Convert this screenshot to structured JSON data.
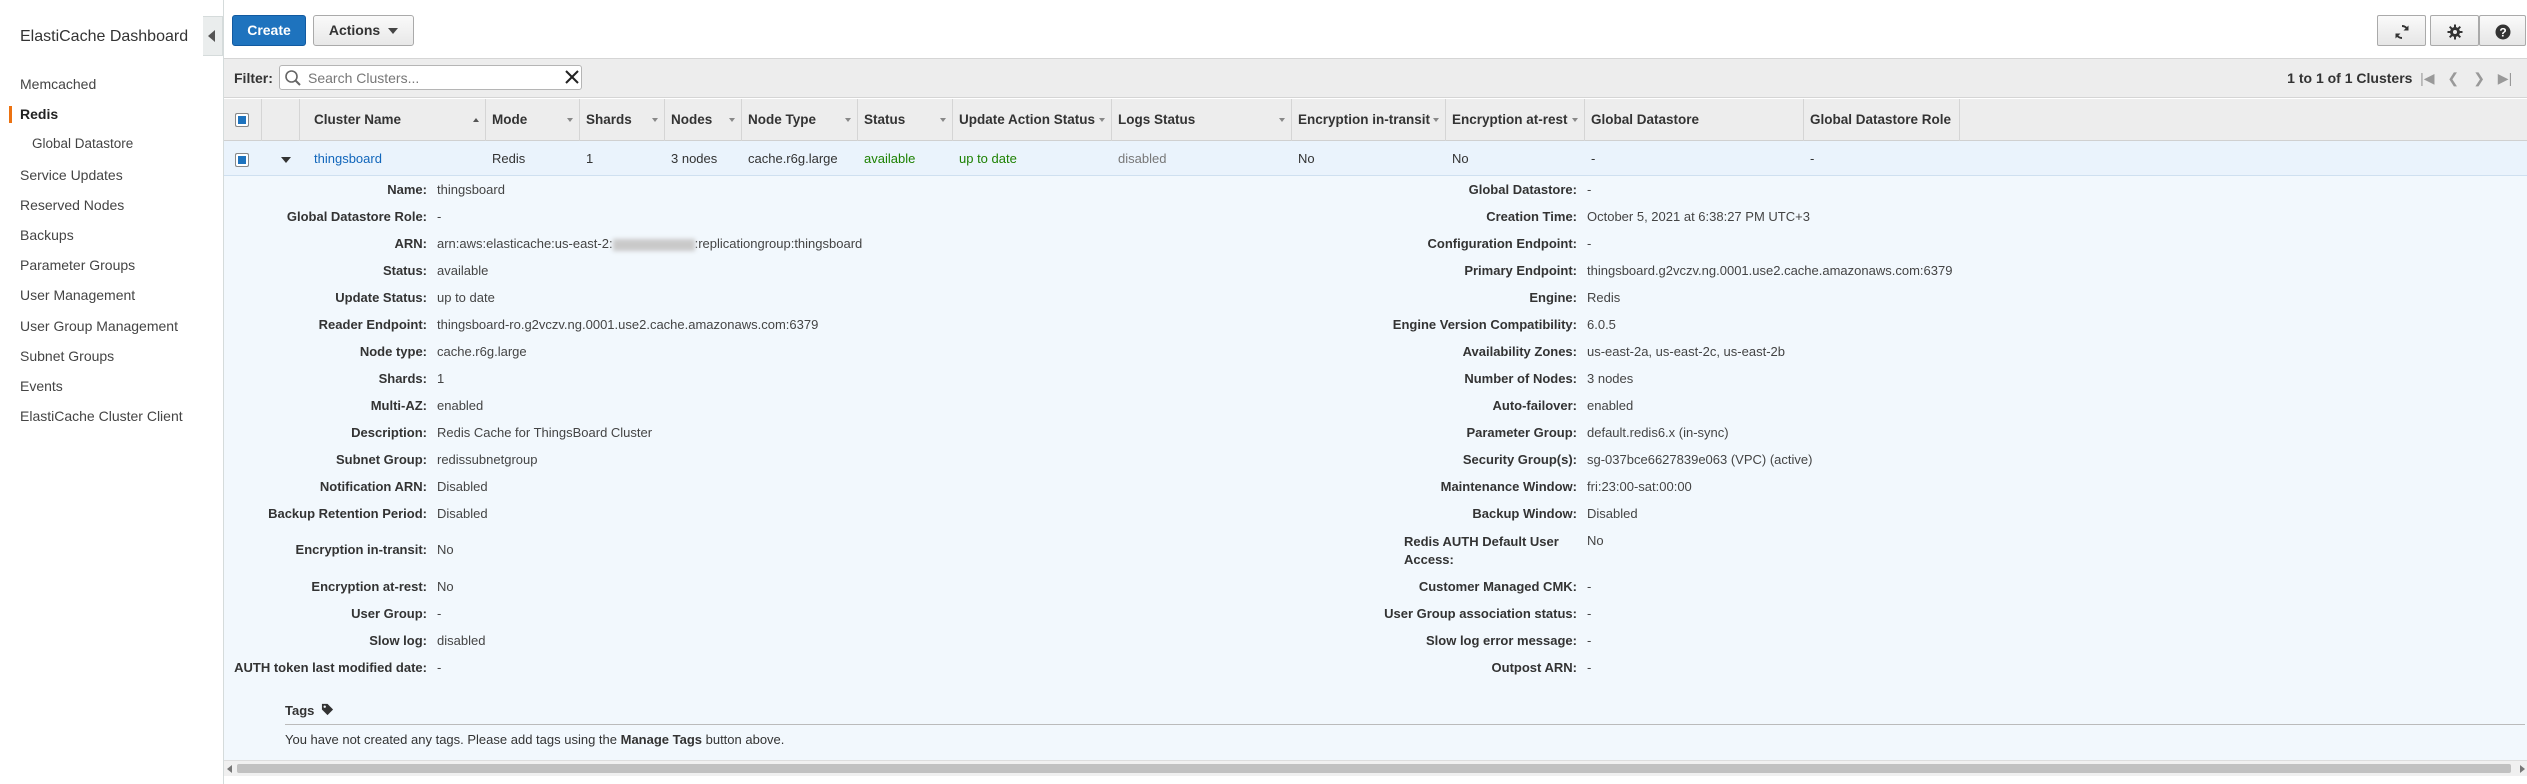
{
  "sidebar": {
    "title": "ElastiCache Dashboard",
    "items": [
      {
        "label": "Memcached"
      },
      {
        "label": "Redis"
      },
      {
        "label": "Global Datastore"
      },
      {
        "label": "Service Updates"
      },
      {
        "label": "Reserved Nodes"
      },
      {
        "label": "Backups"
      },
      {
        "label": "Parameter Groups"
      },
      {
        "label": "User Management"
      },
      {
        "label": "User Group Management"
      },
      {
        "label": "Subnet Groups"
      },
      {
        "label": "Events"
      },
      {
        "label": "ElastiCache Cluster Client"
      }
    ]
  },
  "toolbar": {
    "create_label": "Create",
    "actions_label": "Actions"
  },
  "filter": {
    "label": "Filter:",
    "placeholder": "Search Clusters...",
    "pager_text": "1 to 1 of 1 Clusters"
  },
  "table": {
    "columns": [
      "Cluster Name",
      "Mode",
      "Shards",
      "Nodes",
      "Node Type",
      "Status",
      "Update Action Status",
      "Logs Status",
      "Encryption in-transit",
      "Encryption at-rest",
      "Global Datastore",
      "Global Datastore Role"
    ],
    "row": {
      "cluster_name": "thingsboard",
      "mode": "Redis",
      "shards": "1",
      "nodes": "3 nodes",
      "node_type": "cache.r6g.large",
      "status": "available",
      "update_action_status": "up to date",
      "logs_status": "disabled",
      "enc_transit": "No",
      "enc_rest": "No",
      "global_datastore": "-",
      "global_datastore_role": "-"
    }
  },
  "details": {
    "left": [
      {
        "label": "Name:",
        "value": "thingsboard"
      },
      {
        "label": "Global Datastore Role:",
        "value": "-"
      },
      {
        "label": "ARN:",
        "value_prefix": "arn:aws:elasticache:us-east-2:",
        "value_suffix": ":replicationgroup:thingsboard"
      },
      {
        "label": "Status:",
        "value": "available"
      },
      {
        "label": "Update Status:",
        "value": "up to date"
      },
      {
        "label": "Reader Endpoint:",
        "value": "thingsboard-ro.g2vczv.ng.0001.use2.cache.amazonaws.com:6379"
      },
      {
        "label": "Node type:",
        "value": "cache.r6g.large"
      },
      {
        "label": "Shards:",
        "value": "1"
      },
      {
        "label": "Multi-AZ:",
        "value": "enabled"
      },
      {
        "label": "Description:",
        "value": "Redis Cache for ThingsBoard Cluster"
      },
      {
        "label": "Subnet Group:",
        "value": "redissubnetgroup"
      },
      {
        "label": "Notification ARN:",
        "value": "Disabled"
      },
      {
        "label": "Backup Retention Period:",
        "value": "Disabled"
      },
      {
        "label": "Encryption in-transit:",
        "value": "No"
      },
      {
        "label": "Encryption at-rest:",
        "value": "No"
      },
      {
        "label": "User Group:",
        "value": "-"
      },
      {
        "label": "Slow log:",
        "value": "disabled"
      },
      {
        "label": "AUTH token last modified date:",
        "value": "-"
      }
    ],
    "right": [
      {
        "label": "Global Datastore:",
        "value": "-"
      },
      {
        "label": "Creation Time:",
        "value": "October 5, 2021 at 6:38:27 PM UTC+3"
      },
      {
        "label": "Configuration Endpoint:",
        "value": "-"
      },
      {
        "label": "Primary Endpoint:",
        "value": "thingsboard.g2vczv.ng.0001.use2.cache.amazonaws.com:6379"
      },
      {
        "label": "Engine:",
        "value": "Redis"
      },
      {
        "label": "Engine Version Compatibility:",
        "value": "6.0.5"
      },
      {
        "label": "Availability Zones:",
        "value": "us-east-2a, us-east-2c, us-east-2b"
      },
      {
        "label": "Number of Nodes:",
        "value": "3 nodes"
      },
      {
        "label": "Auto-failover:",
        "value": "enabled"
      },
      {
        "label": "Parameter Group:",
        "value": "default.redis6.x (in-sync)"
      },
      {
        "label": "Security Group(s):",
        "value": "sg-037bce6627839e063 (VPC) (active)"
      },
      {
        "label": "Maintenance Window:",
        "value": "fri:23:00-sat:00:00"
      },
      {
        "label": "Backup Window:",
        "value": "Disabled"
      },
      {
        "label_line1": "Redis AUTH Default User",
        "label_line2": "Access:",
        "value": "No"
      },
      {
        "label": "Customer Managed CMK:",
        "value": "-"
      },
      {
        "label": "User Group association status:",
        "value": "-"
      },
      {
        "label": "Slow log error message:",
        "value": "-"
      },
      {
        "label": "Outpost ARN:",
        "value": "-"
      }
    ]
  },
  "tags": {
    "title": "Tags",
    "text_before": "You have not created any tags. Please add tags using the ",
    "text_bold": "Manage Tags",
    "text_after": " button above."
  },
  "colors": {
    "primary_button": "#1e73be",
    "active_accent": "#ec7211",
    "status_green": "#1d8102",
    "link": "#1166bb"
  },
  "icons": [
    "refresh-icon",
    "gear-icon",
    "help-icon",
    "search-icon",
    "clear-icon",
    "tag-icon",
    "chevron-down-icon",
    "collapse-left-icon"
  ]
}
